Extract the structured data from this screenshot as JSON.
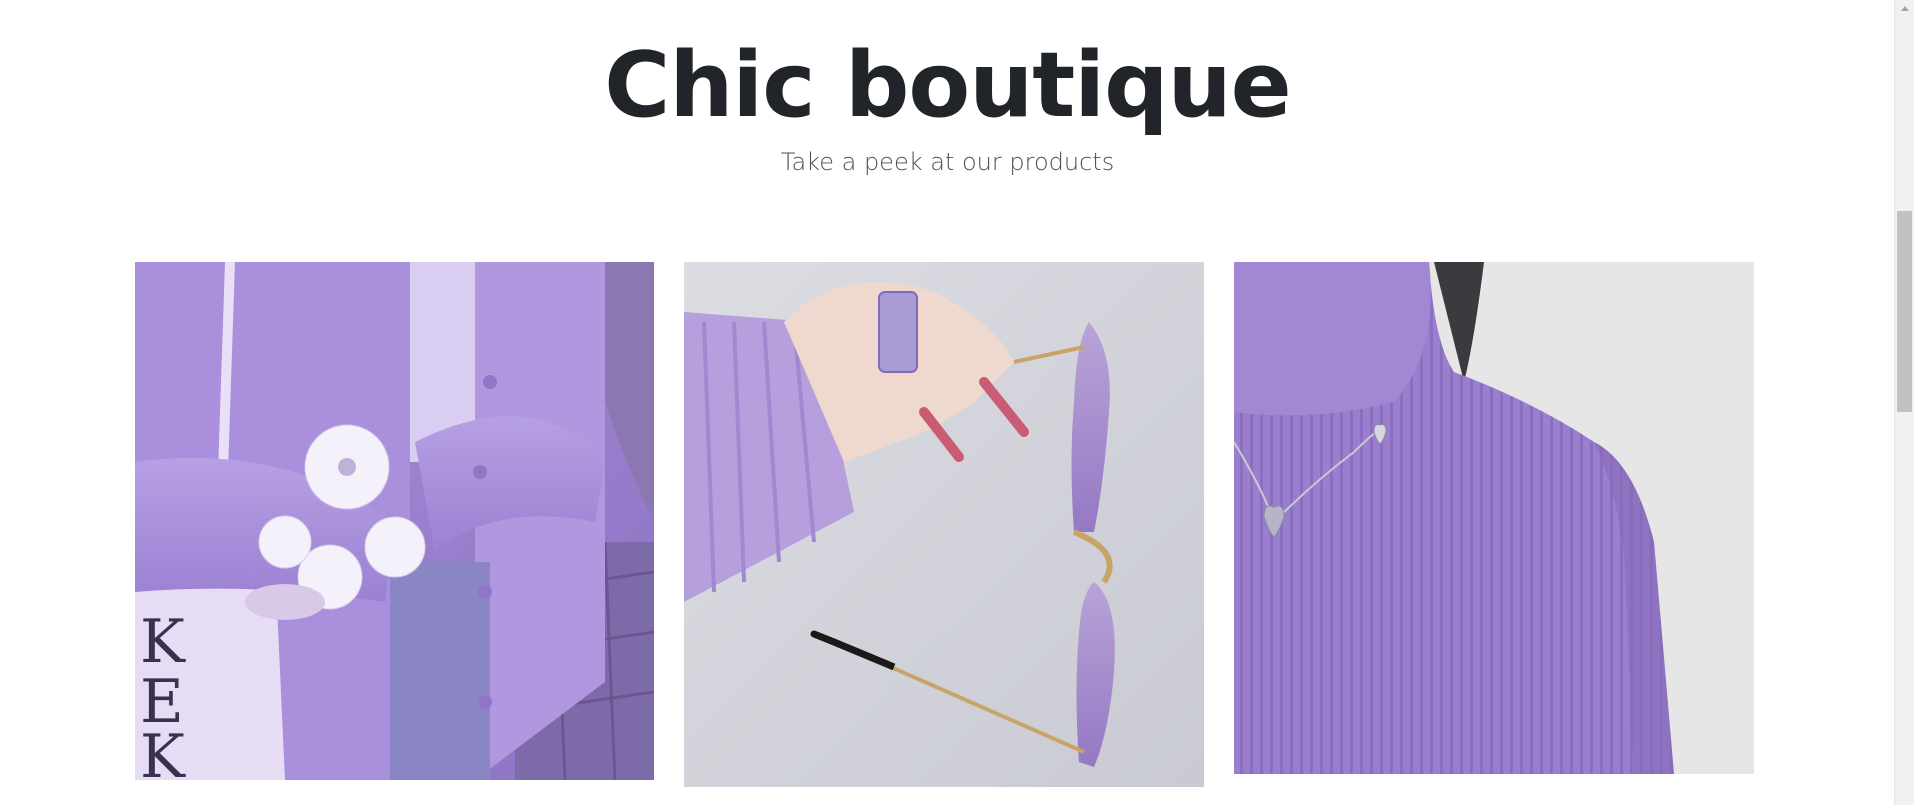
{
  "hero": {
    "title": "Chic boutique",
    "subtitle": "Take a peek at our products"
  },
  "products": [
    {
      "image": "model-in-lavender-cardigan-holding-white-flowers",
      "main_color": "#a58bd6"
    },
    {
      "image": "hand-holding-purple-rimless-sunglasses",
      "main_color": "#b8a2dc"
    },
    {
      "image": "lavender-ribbed-turtleneck-with-heart-necklace",
      "main_color": "#9a7fc9"
    }
  ],
  "colors": {
    "accent_purple": "#9b7fd0",
    "title_text": "#212529",
    "subtitle_text": "#495057"
  }
}
